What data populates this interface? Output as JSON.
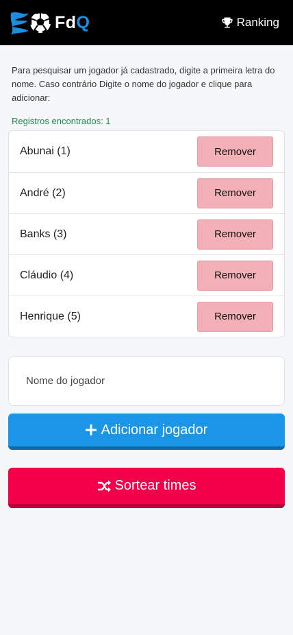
{
  "header": {
    "brand_fd": "Fd",
    "brand_q": "Q",
    "ranking_label": "Ranking"
  },
  "intro_text": "Para pesquisar um jogador já cadastrado, digite a primeira letra do nome. Caso contrário Digite o nome do jogador e clique para adicionar:",
  "records": {
    "label": "Registros encontrados: ",
    "count": "1"
  },
  "players": [
    {
      "name": "Abunai (1)",
      "remove_label": "Remover"
    },
    {
      "name": "André (2)",
      "remove_label": "Remover"
    },
    {
      "name": "Banks (3)",
      "remove_label": "Remover"
    },
    {
      "name": "Cláudio (4)",
      "remove_label": "Remover"
    },
    {
      "name": "Henrique (5)",
      "remove_label": "Remover"
    }
  ],
  "name_input": {
    "placeholder": "Nome do jogador",
    "value": ""
  },
  "add_button_label": "Adicionar jogador",
  "sort_button_label": "Sortear times",
  "icons": {
    "logo": "soccer-ball-flame-icon",
    "ranking": "trophy-icon",
    "add": "plus-icon",
    "sort": "shuffle-icon"
  },
  "colors": {
    "header_bg": "#000000",
    "brand_q": "#1a8fe0",
    "records_text": "#1f8a4c",
    "remove_bg": "#f3b1b7",
    "add_bg": "#1b96e6",
    "sort_bg": "#f2004a"
  }
}
